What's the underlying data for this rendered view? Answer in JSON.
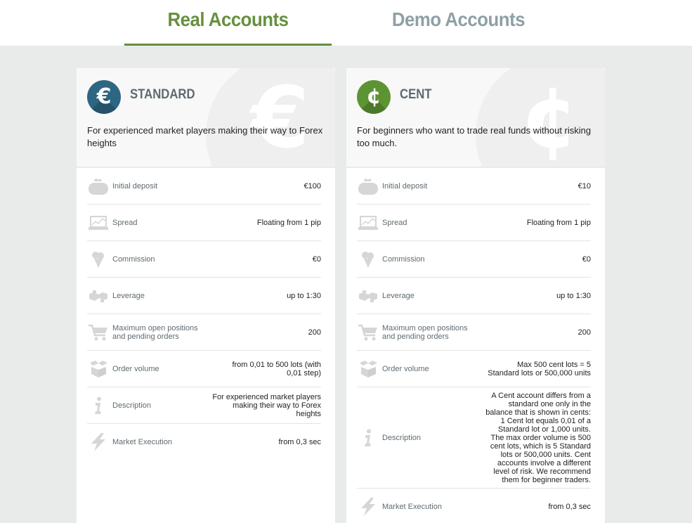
{
  "tabs": {
    "real": "Real Accounts",
    "demo": "Demo Accounts"
  },
  "colors": {
    "accent": "#67903e",
    "tab_inactive": "#8fa0a6",
    "standard_badge": "#2d6683",
    "cent_badge": "#5d9433"
  },
  "standard": {
    "badge_glyph": "€",
    "title": "STANDARD",
    "description": "For experienced market players making their way to Forex heights",
    "rows": [
      {
        "icon": "wallet-icon",
        "label": "Initial deposit",
        "value": "€100"
      },
      {
        "icon": "chart-icon",
        "label": "Spread",
        "value": "Floating from 1 pip"
      },
      {
        "icon": "ice-cream-icon",
        "label": "Commission",
        "value": "€0"
      },
      {
        "icon": "handshake-icon",
        "label": "Leverage",
        "value": "up to 1:30"
      },
      {
        "icon": "cart-icon",
        "label": "Maximum open positions and pending orders",
        "value": "200"
      },
      {
        "icon": "boxes-icon",
        "label": "Order volume",
        "value": "from 0,01 to 500 lots (with 0,01 step)"
      },
      {
        "icon": "info-icon",
        "label": "Description",
        "value": "For experienced market players making their way to Forex heights"
      },
      {
        "icon": "lightning-icon",
        "label": "Market Execution",
        "value": "from 0,3 sec"
      }
    ]
  },
  "cent": {
    "badge_glyph": "¢",
    "title": "CENT",
    "description": "For beginners who want to trade real funds without risking too much.",
    "rows": [
      {
        "icon": "wallet-icon",
        "label": "Initial deposit",
        "value": "€10"
      },
      {
        "icon": "chart-icon",
        "label": "Spread",
        "value": "Floating from 1 pip"
      },
      {
        "icon": "ice-cream-icon",
        "label": "Commission",
        "value": "€0"
      },
      {
        "icon": "handshake-icon",
        "label": "Leverage",
        "value": "up to 1:30"
      },
      {
        "icon": "cart-icon",
        "label": "Maximum open positions and pending orders",
        "value": "200"
      },
      {
        "icon": "boxes-icon",
        "label": "Order volume",
        "value": "Max 500 cent lots = 5 Standard lots or 500,000 units"
      },
      {
        "icon": "info-icon",
        "label": "Description",
        "value": "A Cent account differs from a standard one only in the balance that is shown in cents: 1 Cent lot equals 0,01 of a Standard lot or 1,000 units. The max order volume is 500 cent lots, which is 5 Standard lots or 500,000 units. Cent accounts involve a different level of risk. We recommend them for beginner traders."
      },
      {
        "icon": "lightning-icon",
        "label": "Market Execution",
        "value": "from 0,3 sec"
      }
    ]
  }
}
